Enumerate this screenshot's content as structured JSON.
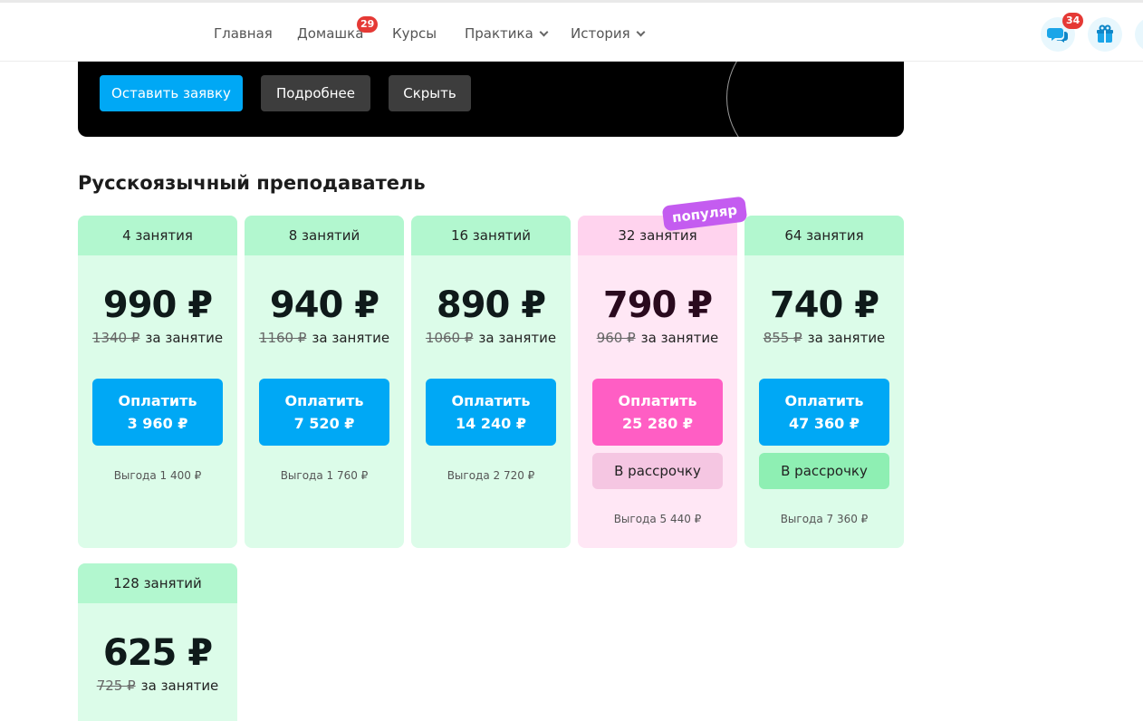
{
  "nav": {
    "items": [
      {
        "label": "Главная"
      },
      {
        "label": "Домашка",
        "badge": "29"
      },
      {
        "label": "Курсы"
      },
      {
        "label": "Практика"
      },
      {
        "label": "История"
      }
    ],
    "chat_badge": "34",
    "icons": [
      "chat-icon",
      "gift-icon"
    ]
  },
  "banner": {
    "apply_label": "Оставить заявку",
    "details_label": "Подробнее",
    "hide_label": "Скрыть"
  },
  "section_title": "Русскоязычный преподаватель",
  "popular_label": "популяр",
  "per_lesson": "за занятие",
  "pay_label": "Оплатить",
  "installment_label": "В рассрочку",
  "plans": [
    {
      "lessons": "4 занятия",
      "price": "990 ₽",
      "old_price": "1340 ₽",
      "total": "3 960 ₽",
      "savings": "Выгода 1 400 ₽"
    },
    {
      "lessons": "8 занятий",
      "price": "940 ₽",
      "old_price": "1160 ₽",
      "total": "7 520 ₽",
      "savings": "Выгода 1 760 ₽"
    },
    {
      "lessons": "16 занятий",
      "price": "890 ₽",
      "old_price": "1060 ₽",
      "total": "14 240 ₽",
      "savings": "Выгода 2 720 ₽"
    },
    {
      "lessons": "32 занятия",
      "price": "790 ₽",
      "old_price": "960 ₽",
      "total": "25 280 ₽",
      "savings": "Выгода 5 440 ₽"
    },
    {
      "lessons": "64 занятия",
      "price": "740 ₽",
      "old_price": "855 ₽",
      "total": "47 360 ₽",
      "savings": "Выгода 7 360 ₽"
    },
    {
      "lessons": "128 занятий",
      "price": "625 ₽",
      "old_price": "725 ₽"
    }
  ],
  "colors": {
    "accent_blue": "#00a8f5",
    "accent_pink": "#ff5ec4",
    "card_green": "#dcfce9",
    "card_pink": "#ffe7f5",
    "popular_purple": "#c45cf0"
  }
}
